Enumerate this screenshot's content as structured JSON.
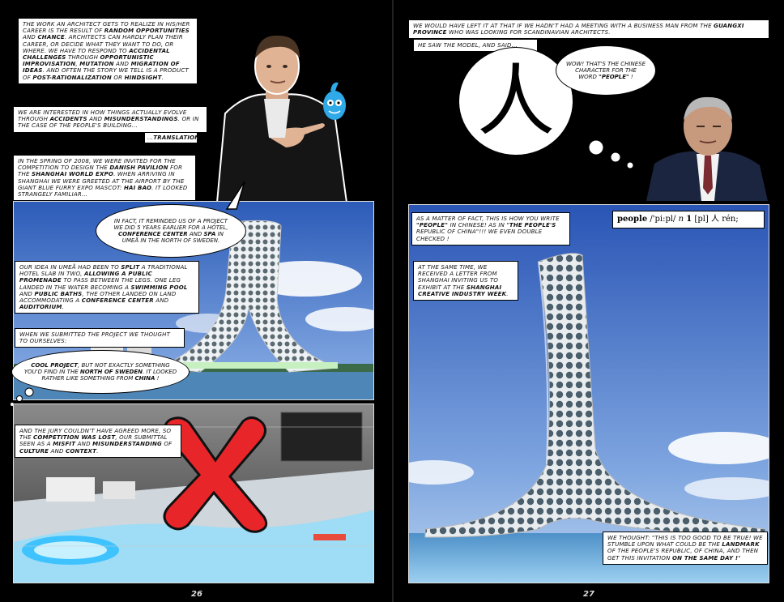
{
  "page_left": {
    "number": "26",
    "cap1_a": "The work an architect gets to realize in his/her career is the result of ",
    "cap1_b": "random opportunities",
    "cap1_c": " and ",
    "cap1_d": "chance",
    "cap1_e": ". Architects can hardly plan their career, or decide what they want to do, or where. We have to respond to ",
    "cap1_f": "accidental challenges",
    "cap1_g": " through ",
    "cap1_h": "opportunistic improvisation",
    "cap1_i": ", ",
    "cap1_j": "mutation",
    "cap1_k": " and ",
    "cap1_l": "migration of ideas",
    "cap1_m": ". And often the story we tell is a product of ",
    "cap1_n": "post-rationalization",
    "cap1_o": " or ",
    "cap1_p": "hindsight",
    "cap1_q": ".",
    "cap2_a": "We are interested in how things actually evolve through ",
    "cap2_b": "accidents",
    "cap2_c": " and ",
    "cap2_d": "misunderstandings",
    "cap2_e": ". Or in the case of the people's building...",
    "cap3_a": "...",
    "cap3_b": "translation",
    "cap3_c": ".",
    "cap4_a": "In the spring of 2008, we were invited for the competition to design the ",
    "cap4_b": "Danish Pavilion",
    "cap4_c": " for the ",
    "cap4_d": "Shanghai World Expo",
    "cap4_e": ". When arriving in Shanghai we were greeted at the airport by the giant blue furry Expo mascot: ",
    "cap4_f": "Hai Bao",
    "cap4_g": ". It looked strangely familiar...",
    "bubble1_a": "In fact, it reminded us of a project we did 5 years earlier for a hotel, ",
    "bubble1_b": "conference center",
    "bubble1_c": " and ",
    "bubble1_d": "spa",
    "bubble1_e": " in Umeå in the north of Sweden.",
    "cap5_a": "Our idea in Umeå had been to ",
    "cap5_b": "split",
    "cap5_c": " a traditional hotel slab in two, ",
    "cap5_d": "allowing a public promenade",
    "cap5_e": " to pass between the legs. One leg landed in the water becoming a ",
    "cap5_f": "swimming pool",
    "cap5_g": " and ",
    "cap5_h": "public baths",
    "cap5_i": ", the other landed on land accommodating a ",
    "cap5_j": "conference center",
    "cap5_k": " and ",
    "cap5_l": "auditorium",
    "cap5_m": ".",
    "cap6": "When we submitted the project we thought to ourselves:",
    "bubble2_a": "Cool project",
    "bubble2_b": ", but not exactly something you'd find in the ",
    "bubble2_c": "north of Sweden",
    "bubble2_d": ". It looked rather like something from ",
    "bubble2_e": "China",
    "bubble2_f": " !",
    "cap7_a": "And the jury couldn't have agreed more, so the ",
    "cap7_b": "competition was lost",
    "cap7_c": ", our submittal seen as a ",
    "cap7_d": "misfit",
    "cap7_e": " and ",
    "cap7_f": "misunderstanding",
    "cap7_g": " of ",
    "cap7_h": "culture",
    "cap7_i": " and ",
    "cap7_j": "context",
    "cap7_k": "."
  },
  "page_right": {
    "number": "27",
    "cap1_a": "We would have left it at that if we hadn't had a meeting with a business man from the ",
    "cap1_b": "Guangxi province",
    "cap1_c": " who was looking for Scandinavian architects.",
    "cap2": "He saw the model, and said...",
    "glyph": "人",
    "bubble_a": "Wow! That's the Chinese character for the word ",
    "bubble_b": "\"people\"",
    "bubble_c": " !",
    "dict_word": "people",
    "dict_pron": "/'pi:pl/",
    "dict_pos": "n",
    "dict_num": "1",
    "dict_sense": "[pl]",
    "dict_char": "人",
    "dict_pinyin": "rén;",
    "cap3_a": "As a matter of fact, this is how you write ",
    "cap3_b": "\"people\"",
    "cap3_c": " in Chinese! As in \"",
    "cap3_d": "The people's",
    "cap3_e": " Republic of China\"!!! We even double checked !",
    "cap4_a": "At the same time, we received a letter from Shanghai inviting us to exhibit at the ",
    "cap4_b": "Shanghai Creative Industry Week",
    "cap4_c": ".",
    "cap5_a": "We thought: \"This is too good to be true! We stumble upon what could be the ",
    "cap5_b": "landmark",
    "cap5_c": " of the people's republic, of China, and then get this invitation ",
    "cap5_d": "on the same day !",
    "cap5_e": "\""
  },
  "colors": {
    "background": "#000000",
    "sky": "#3f6fc0",
    "water": "#8fd4ff",
    "cross": "#e8262a"
  }
}
